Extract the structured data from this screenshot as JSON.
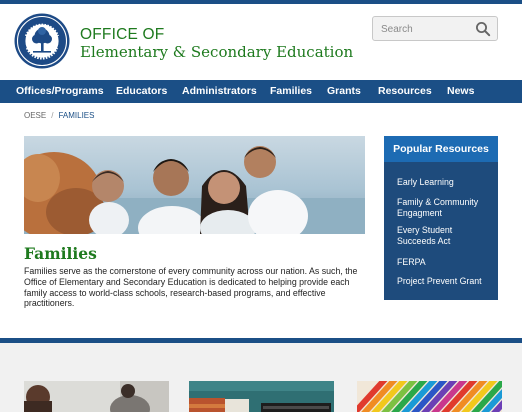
{
  "header": {
    "seal_icon": "department-of-education-seal",
    "office_line1": "OFFICE OF",
    "office_line2": "Elementary & Secondary Education",
    "search": {
      "placeholder": "Search",
      "icon": "search-icon"
    }
  },
  "nav": {
    "items": [
      "Offices/Programs",
      "Educators",
      "Administrators",
      "Families",
      "Grants",
      "Resources",
      "News"
    ]
  },
  "breadcrumb": {
    "root": "OESE",
    "separator": "/",
    "current": "FAMILIES"
  },
  "main": {
    "title": "Families",
    "description": "Families serve as the cornerstone of every community across our nation. As such, the Office of Elementary and Secondary Education is dedicated to helping provide each family access to world-class schools, research-based programs, and effective practitioners."
  },
  "popular": {
    "title": "Popular Resources",
    "items": [
      [
        "Early Learning"
      ],
      [
        "Family & Community",
        "Engagment"
      ],
      [
        "Every Student",
        "Succeeds Act"
      ],
      [
        "FERPA"
      ],
      [
        "Project Prevent Grant"
      ]
    ]
  },
  "colors": {
    "nav_blue": "#1b4f86",
    "accent_blue": "#1d6bb3",
    "title_green": "#1e7a1e"
  }
}
